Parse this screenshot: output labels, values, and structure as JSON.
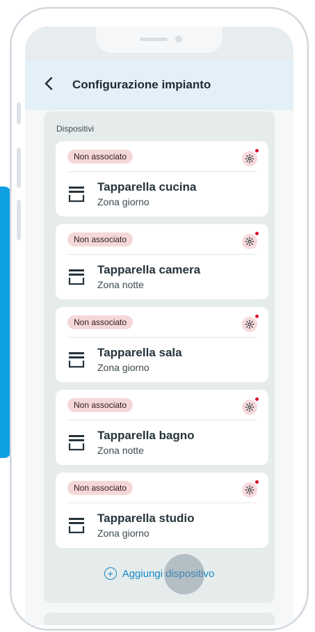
{
  "header": {
    "back_icon": "chevron-left-icon",
    "back_symbol": "‹",
    "title": "Configurazione impianto"
  },
  "section": {
    "label": "Dispositivi"
  },
  "devices": [
    {
      "status": "Non associato",
      "name": "Tapparella cucina",
      "zone": "Zona giorno"
    },
    {
      "status": "Non associato",
      "name": "Tapparella camera",
      "zone": "Zona notte"
    },
    {
      "status": "Non associato",
      "name": "Tapparella sala",
      "zone": "Zona giorno"
    },
    {
      "status": "Non associato",
      "name": "Tapparella bagno",
      "zone": "Zona notte"
    },
    {
      "status": "Non associato",
      "name": "Tapparella studio",
      "zone": "Zona giorno"
    }
  ],
  "add_device": {
    "label": "Aggiungi dispositivo",
    "icon": "plus-circle-icon"
  },
  "colors": {
    "accent": "#1688c7",
    "badge_bg": "#f6d7d9",
    "alert_dot": "#e0102a",
    "header_bg": "#e4f0f7",
    "panel_bg": "#e6eceb"
  }
}
